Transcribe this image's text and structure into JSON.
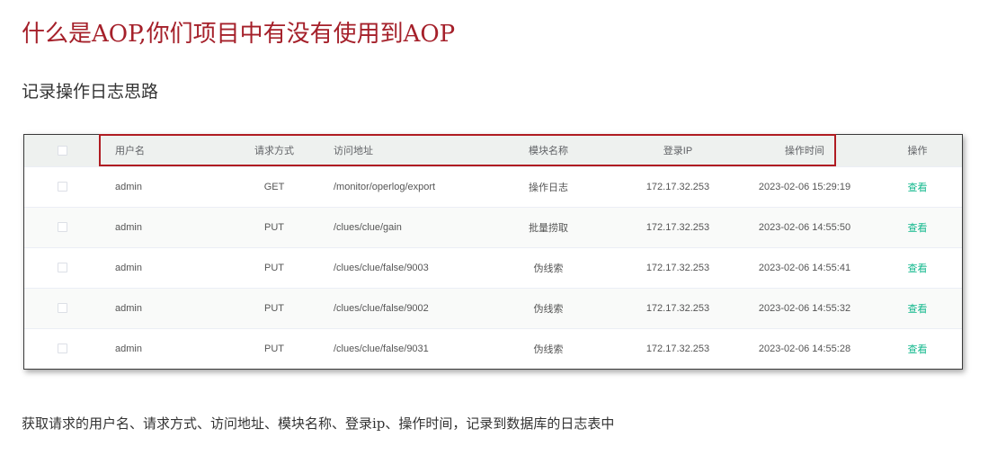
{
  "page": {
    "title": "什么是AOP,你们项目中有没有使用到AOP",
    "section_heading": "记录操作日志思路",
    "caption": "获取请求的用户名、请求方式、访问地址、模块名称、登录ip、操作时间，记录到数据库的日志表中"
  },
  "table": {
    "headers": {
      "username": "用户名",
      "method": "请求方式",
      "url": "访问地址",
      "module": "模块名称",
      "ip": "登录IP",
      "time": "操作时间",
      "action": "操作"
    },
    "rows": [
      {
        "username": "admin",
        "method": "GET",
        "url": "/monitor/operlog/export",
        "module": "操作日志",
        "ip": "172.17.32.253",
        "time": "2023-02-06 15:29:19",
        "action": "查看"
      },
      {
        "username": "admin",
        "method": "PUT",
        "url": "/clues/clue/gain",
        "module": "批量捞取",
        "ip": "172.17.32.253",
        "time": "2023-02-06 14:55:50",
        "action": "查看"
      },
      {
        "username": "admin",
        "method": "PUT",
        "url": "/clues/clue/false/9003",
        "module": "伪线索",
        "ip": "172.17.32.253",
        "time": "2023-02-06 14:55:41",
        "action": "查看"
      },
      {
        "username": "admin",
        "method": "PUT",
        "url": "/clues/clue/false/9002",
        "module": "伪线索",
        "ip": "172.17.32.253",
        "time": "2023-02-06 14:55:32",
        "action": "查看"
      },
      {
        "username": "admin",
        "method": "PUT",
        "url": "/clues/clue/false/9031",
        "module": "伪线索",
        "ip": "172.17.32.253",
        "time": "2023-02-06 14:55:28",
        "action": "查看"
      }
    ]
  },
  "colors": {
    "title": "#a5202a",
    "highlight_border": "#b01c22",
    "link": "#13b88d",
    "header_bg": "#eef1ef"
  }
}
